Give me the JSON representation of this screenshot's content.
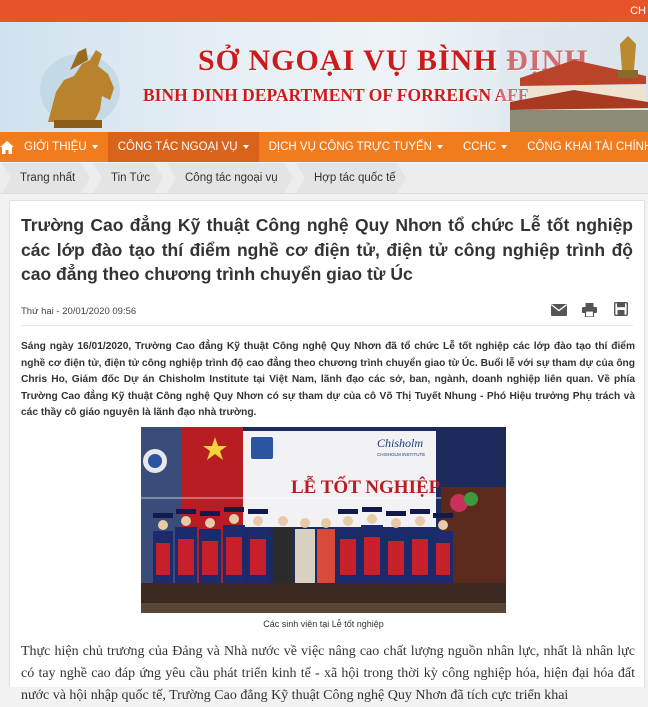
{
  "topbar": {
    "right_text": "CH"
  },
  "banner": {
    "title": "SỞ NGOẠI VỤ BÌNH ĐỊNH",
    "subtitle": "BINH DINH DEPARTMENT OF FORREIGN AFFAIRS"
  },
  "nav": {
    "items": [
      {
        "label": "GIỚI THIỆU",
        "dropdown": true
      },
      {
        "label": "CÔNG TÁC NGOẠI VỤ",
        "dropdown": true,
        "active": true
      },
      {
        "label": "DỊCH VỤ CÔNG TRỰC TUYẾN",
        "dropdown": true
      },
      {
        "label": "CCHC",
        "dropdown": true
      },
      {
        "label": "CÔNG KHAI TÀI CHÍNH",
        "dropdown": false
      }
    ]
  },
  "breadcrumb": [
    "Trang nhất",
    "Tin Tức",
    "Công tác ngoại vụ",
    "Hợp tác quốc tế"
  ],
  "article": {
    "title": "Trường Cao đẳng Kỹ thuật Công nghệ Quy Nhơn tổ chức Lễ tốt nghiệp các lớp đào tạo thí điểm nghề cơ điện tử, điện tử công nghiệp trình độ cao đẳng theo chương trình chuyển giao từ Úc",
    "date": "Thứ hai - 20/01/2020 09:56",
    "lead": "Sáng ngày 16/01/2020, Trường Cao đẳng Kỹ thuật Công nghệ Quy Nhơn đã tổ chức Lễ tốt nghiệp các lớp đào tạo thí điểm nghề cơ điện tử, điện tử công nghiệp trình độ cao đẳng theo chương trình chuyển giao từ Úc. Buổi lễ với sự tham dự của ông Chris Ho, Giám đốc Dự án Chisholm Institute tại Việt Nam, lãnh đạo các sở, ban, ngành, doanh nghiệp liên quan. Về phía Trường Cao đẳng Kỹ thuật Công nghệ Quy Nhơn có sự tham dự của cô Võ Thị Tuyết Nhung - Phó Hiệu trưởng Phụ trách và các thầy cô giáo nguyên là lãnh đạo nhà trường.",
    "photo": {
      "banner_text": "LỄ TỐT NGHIỆP",
      "logo_text": "Chisholm",
      "logo_sub": "CHISHOLM INSTITUTE"
    },
    "caption": "Các sinh viên tại Lễ tốt nghiệp",
    "body": "Thực hiện chủ trương của Đảng và Nhà nước về việc nâng cao chất lượng nguồn nhân lực, nhất là nhân lực có tay nghề cao đáp ứng yêu cầu phát triển kinh tế - xã hội trong thời kỳ công nghiệp hóa, hiện đại hóa đất nước và hội nhập quốc tế, Trường Cao đẳng Kỹ thuật Công nghệ Quy Nhơn đã tích cực triển khai"
  },
  "icons": {
    "home": "home-icon",
    "email": "email-icon",
    "print": "print-icon",
    "save": "save-icon"
  },
  "colors": {
    "nav": "#f07c1e",
    "nav_active": "#d9631a",
    "topbar": "#e8542a",
    "banner_title": "#cc1b1b"
  }
}
